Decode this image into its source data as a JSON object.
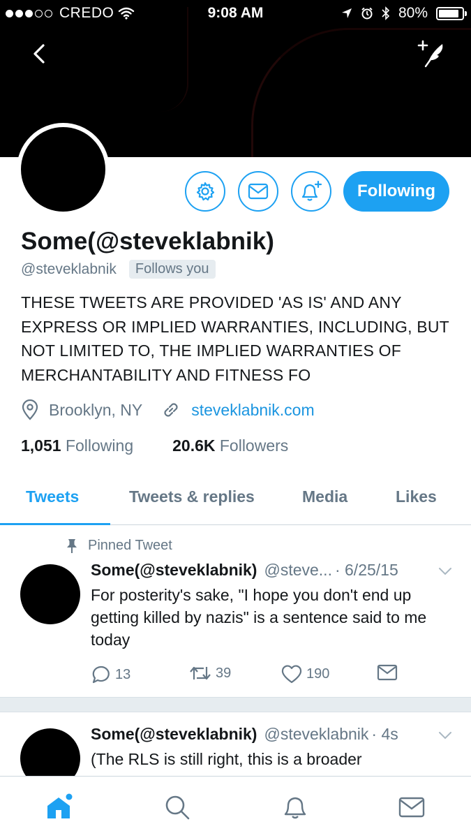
{
  "status_bar": {
    "carrier": "CREDO",
    "time": "9:08 AM",
    "battery": "80%"
  },
  "profile": {
    "name": "Some(@steveklabnik)",
    "handle": "@steveklabnik",
    "follows_you": "Follows you",
    "follow_button": "Following",
    "bio": "THESE TWEETS ARE PROVIDED 'AS IS' AND ANY EXPRESS OR IMPLIED WARRANTIES, INCLUDING, BUT NOT LIMITED TO, THE IMPLIED WARRANTIES OF MERCHANTABILITY AND FITNESS FO",
    "location": "Brooklyn, NY",
    "website": "steveklabnik.com",
    "following_count": "1,051",
    "following_label": "Following",
    "followers_count": "20.6K",
    "followers_label": "Followers"
  },
  "tabs": [
    {
      "label": "Tweets",
      "active": true
    },
    {
      "label": "Tweets & replies",
      "active": false
    },
    {
      "label": "Media",
      "active": false
    },
    {
      "label": "Likes",
      "active": false
    }
  ],
  "tweets": [
    {
      "pinned_label": "Pinned Tweet",
      "name": "Some(@steveklabnik)",
      "handle": "@steve...",
      "date": "· 6/25/15",
      "text": "For posterity's sake, \"I hope you don't end up getting killed by nazis\" is a sentence said to me today",
      "replies": "13",
      "retweets": "39",
      "likes": "190"
    },
    {
      "name": "Some(@steveklabnik)",
      "handle": "@steveklabnik",
      "date": "· 4s",
      "text": "(The RLS is still right, this is a broader"
    }
  ],
  "colors": {
    "accent": "#1da1f2",
    "link": "#1b95e0",
    "muted": "#657786",
    "text": "#14171a",
    "divider": "#e6ecf0"
  },
  "icons": {
    "back": "chevron-left-icon",
    "compose": "add-feather-icon",
    "settings": "gear-icon",
    "message": "envelope-icon",
    "notifications": "bell-plus-icon",
    "location": "location-pin-icon",
    "link": "link-icon",
    "pin": "pin-icon",
    "reply": "reply-bubble-icon",
    "retweet": "retweet-icon",
    "like": "heart-icon",
    "dm": "envelope-icon",
    "tab_home": "home-icon",
    "tab_search": "search-icon",
    "tab_notifications": "bell-icon",
    "tab_messages": "envelope-icon"
  }
}
